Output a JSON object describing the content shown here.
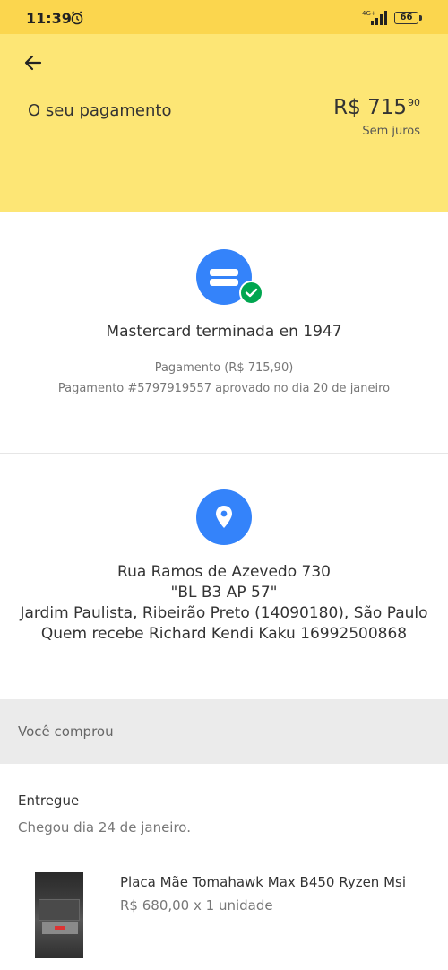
{
  "status_bar": {
    "time": "11:39",
    "network": "4G+",
    "battery": "66"
  },
  "header": {
    "title": "O seu pagamento",
    "price_main": "R$ 715",
    "price_cents": "90",
    "price_note": "Sem juros"
  },
  "payment": {
    "card_title": "Mastercard terminada en 1947",
    "amount_line": "Pagamento (R$ 715,90)",
    "approval_line": "Pagamento #5797919557 aprovado no dia 20 de janeiro"
  },
  "address": {
    "line1": "Rua Ramos de Azevedo 730",
    "line2": "\"BL B3 AP 57\"",
    "line3": "Jardim Paulista, Ribeirão Preto (14090180), São Paulo",
    "line4": "Quem recebe Richard Kendi Kaku 16992500868"
  },
  "purchase": {
    "section_label": "Você comprou",
    "status": "Entregue",
    "delivery_note": "Chegou dia 24 de janeiro.",
    "item": {
      "name": "Placa Mãe Tomahawk Max B450 Ryzen Msi",
      "price_qty": "R$ 680,00 x 1 unidade"
    }
  },
  "colors": {
    "header_yellow": "#fde675",
    "status_yellow": "#fbd64e",
    "accent_blue": "#3483fa",
    "success_green": "#00a650"
  }
}
